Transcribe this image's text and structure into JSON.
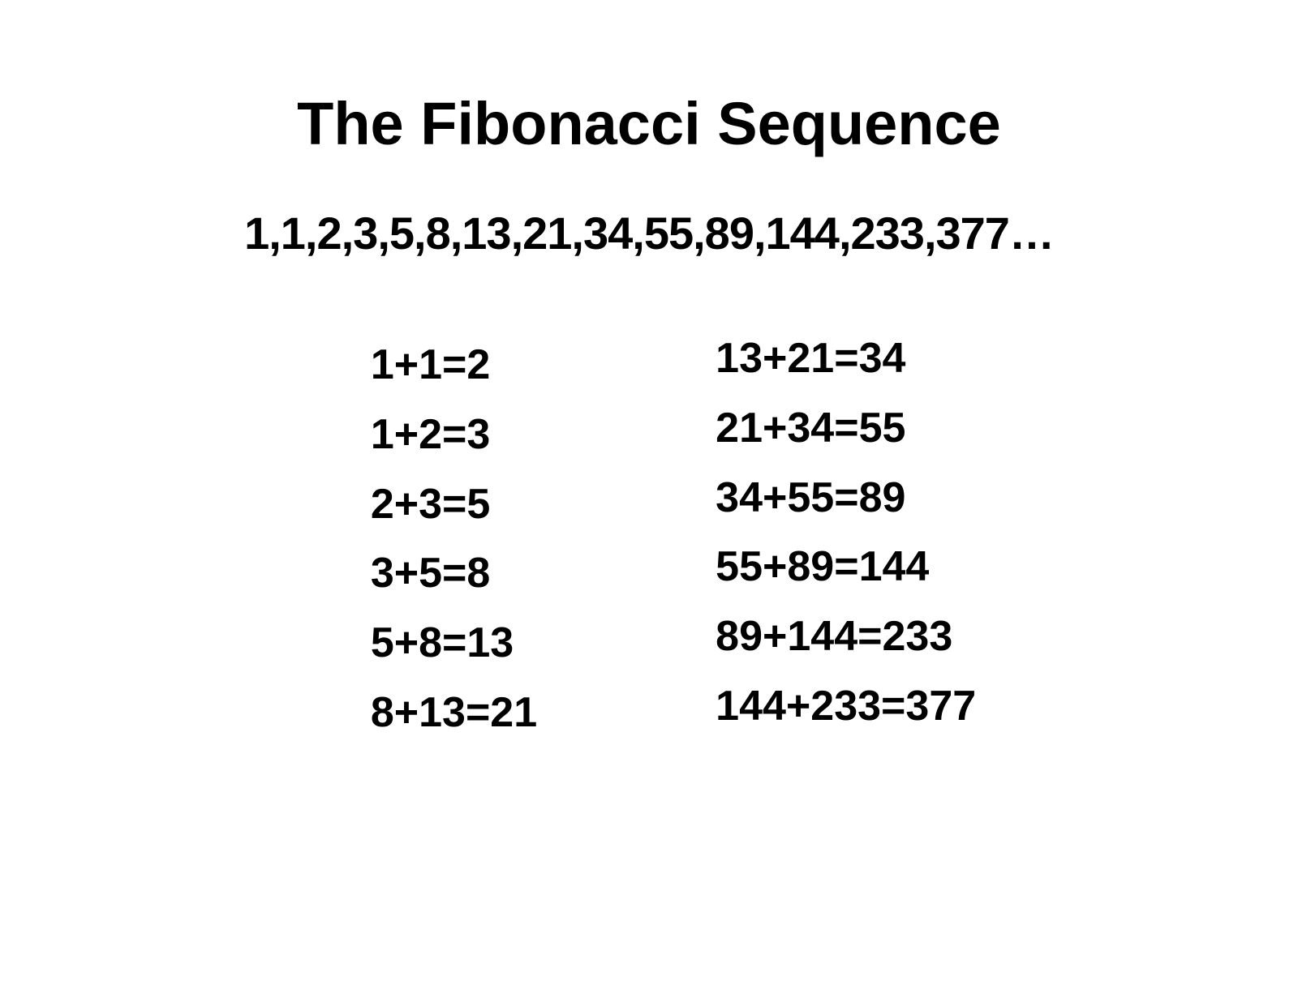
{
  "title": "The Fibonacci Sequence",
  "sequence": "1,1,2,3,5,8,13,21,34,55,89,144,233,377…",
  "left": [
    "1+1=2",
    "1+2=3",
    "2+3=5",
    "3+5=8",
    "5+8=13",
    "8+13=21"
  ],
  "right": [
    "13+21=34",
    "21+34=55",
    "34+55=89",
    "55+89=144",
    "89+144=233",
    "144+233=377"
  ]
}
